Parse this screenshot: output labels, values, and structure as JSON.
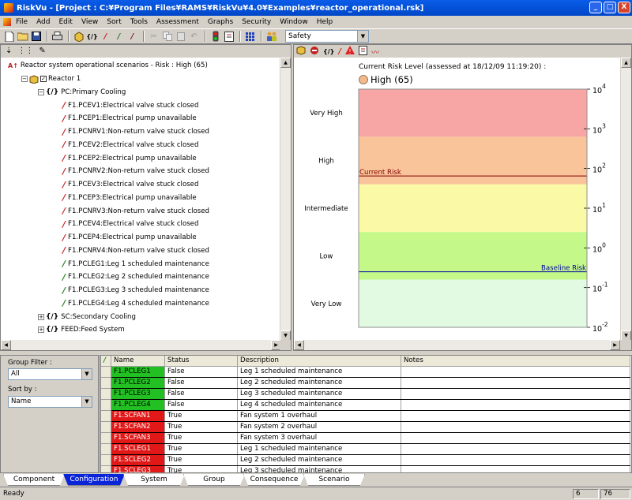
{
  "window": {
    "title": "RiskVu - [Project : C:¥Program Files¥RAMS¥RiskVu¥4.0¥Examples¥reactor_operational.rsk]",
    "min": "_",
    "max": "□",
    "close": "X"
  },
  "menu": [
    "File",
    "Add",
    "Edit",
    "View",
    "Sort",
    "Tools",
    "Assessment",
    "Graphs",
    "Security",
    "Window",
    "Help"
  ],
  "toolbar": {
    "view_select_value": "Safety"
  },
  "tree": {
    "root": "Reactor system operational scenarios - Risk : High (65)",
    "group": "Reactor 1",
    "subgroup": "PC:Primary Cooling",
    "items": [
      {
        "label": "F1.PCEV1:Electrical valve stuck closed",
        "state": "red"
      },
      {
        "label": "F1.PCEP1:Electrical pump unavailable",
        "state": "red"
      },
      {
        "label": "F1.PCNRV1:Non-return valve stuck closed",
        "state": "red"
      },
      {
        "label": "F1.PCEV2:Electrical valve stuck closed",
        "state": "red"
      },
      {
        "label": "F1.PCEP2:Electrical pump unavailable",
        "state": "red"
      },
      {
        "label": "F1.PCNRV2:Non-return valve stuck closed",
        "state": "red"
      },
      {
        "label": "F1.PCEV3:Electrical valve stuck closed",
        "state": "red"
      },
      {
        "label": "F1.PCEP3:Electrical pump unavailable",
        "state": "red"
      },
      {
        "label": "F1.PCNRV3:Non-return valve stuck closed",
        "state": "red"
      },
      {
        "label": "F1.PCEV4:Electrical valve stuck closed",
        "state": "red"
      },
      {
        "label": "F1.PCEP4:Electrical pump unavailable",
        "state": "red"
      },
      {
        "label": "F1.PCNRV4:Non-return valve stuck closed",
        "state": "red"
      },
      {
        "label": "F1.PCLEG1:Leg 1 scheduled maintenance",
        "state": "green"
      },
      {
        "label": "F1.PCLEG2:Leg 2 scheduled maintenance",
        "state": "green"
      },
      {
        "label": "F1.PCLEG3:Leg 3 scheduled maintenance",
        "state": "green"
      },
      {
        "label": "F1.PCLEG4:Leg 4 scheduled maintenance",
        "state": "green"
      }
    ],
    "siblings": [
      "SC:Secondary Cooling",
      "FEED:Feed System"
    ],
    "check_mark": "✓",
    "plus": "+",
    "minus": "−",
    "group_icon_text": "{/}"
  },
  "risk_chart": {
    "heading": "Current Risk Level (assessed at 18/12/09 11:19:20) :",
    "level_text": "High (65)",
    "level_marker_color": "#f4b98a",
    "bands": [
      {
        "label": "Very High",
        "color": "#f7a5a5"
      },
      {
        "label": "High",
        "color": "#f9c49a"
      },
      {
        "label": "Intermediate",
        "color": "#fafaa6"
      },
      {
        "label": "Low",
        "color": "#c4f98a"
      },
      {
        "label": "Very Low",
        "color": "#e2fae2"
      }
    ],
    "axis": {
      "scale": "log",
      "ticks": [
        {
          "base": "10",
          "exp": "4"
        },
        {
          "base": "10",
          "exp": "3"
        },
        {
          "base": "10",
          "exp": "2"
        },
        {
          "base": "10",
          "exp": "1"
        },
        {
          "base": "10",
          "exp": "0"
        },
        {
          "base": "10",
          "exp": "-1"
        },
        {
          "base": "10",
          "exp": "-2"
        }
      ]
    },
    "current_line": {
      "label": "Current Risk",
      "value": 65,
      "color": "#800000"
    },
    "baseline_line": {
      "label": "Baseline Risk",
      "value": 0.25,
      "color": "#0000a0"
    }
  },
  "filter": {
    "group_filter_label": "Group Filter :",
    "group_filter_value": "All",
    "sort_by_label": "Sort by :",
    "sort_by_value": "Name"
  },
  "grid": {
    "columns": [
      "Name",
      "Status",
      "Description",
      "Notes"
    ],
    "rows": [
      {
        "name": "F1.PCLEG1",
        "status": "False",
        "description": "Leg 1 scheduled maintenance",
        "notes": ""
      },
      {
        "name": "F1.PCLEG2",
        "status": "False",
        "description": "Leg 2 scheduled maintenance",
        "notes": ""
      },
      {
        "name": "F1.PCLEG3",
        "status": "False",
        "description": "Leg 3 scheduled maintenance",
        "notes": ""
      },
      {
        "name": "F1.PCLEG4",
        "status": "False",
        "description": "Leg 4 scheduled maintenance",
        "notes": ""
      },
      {
        "name": "F1.SCFAN1",
        "status": "True",
        "description": "Fan system 1 overhaul",
        "notes": ""
      },
      {
        "name": "F1.SCFAN2",
        "status": "True",
        "description": "Fan system 2 overhaul",
        "notes": ""
      },
      {
        "name": "F1.SCFAN3",
        "status": "True",
        "description": "Fan system 3 overhaul",
        "notes": ""
      },
      {
        "name": "F1.SCLEG1",
        "status": "True",
        "description": "Leg 1 scheduled maintenance",
        "notes": ""
      },
      {
        "name": "F1.SCLEG2",
        "status": "True",
        "description": "Leg 2 scheduled maintenance",
        "notes": ""
      },
      {
        "name": "F1.SCLEG3",
        "status": "True",
        "description": "Leg 3 scheduled maintenance",
        "notes": ""
      }
    ]
  },
  "tabs": [
    {
      "label": "Component",
      "active": false
    },
    {
      "label": "Configuration",
      "active": true
    },
    {
      "label": "System",
      "active": false
    },
    {
      "label": "Group",
      "active": false
    },
    {
      "label": "Consequence",
      "active": false
    },
    {
      "label": "Scenario",
      "active": false
    }
  ],
  "status": {
    "text": "Ready",
    "cell1": "6",
    "cell2": "76"
  }
}
